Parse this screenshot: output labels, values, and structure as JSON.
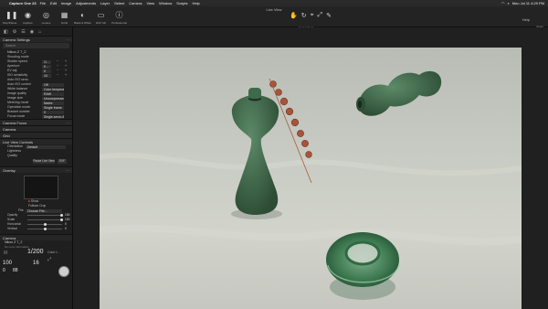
{
  "menubar": {
    "apple": "",
    "app": "Capture One 23",
    "items": [
      "File",
      "Edit",
      "Image",
      "Adjustments",
      "Layer",
      "Select",
      "Camera",
      "View",
      "Window",
      "Scripts",
      "Help"
    ],
    "clock": "Mon Jul 11  4:29 PM"
  },
  "toolbar": {
    "window_title": "Live View",
    "tools": [
      {
        "label": "Stop/Pause",
        "icon": "pause-icon",
        "glyph": "❚❚"
      },
      {
        "label": "Capture",
        "icon": "camera-icon",
        "glyph": "◉"
      },
      {
        "label": "Lenses",
        "icon": "lens-icon",
        "glyph": "◎"
      },
      {
        "label": "Grids",
        "icon": "grid-icon",
        "glyph": "▦"
      },
      {
        "label": "Black & White",
        "icon": "black-white-icon",
        "glyph": "◐"
      },
      {
        "label": "EVF full",
        "icon": "evf-icon",
        "glyph": "▭"
      },
      {
        "label": "Professional",
        "icon": "info-icon",
        "glyph": "ⓘ"
      }
    ],
    "cursor_tools_label": "Cursor Tools",
    "cursor_tools": [
      "✋",
      "↻",
      "⌖",
      "⤢",
      "✎"
    ],
    "right_label": "Help",
    "right_label2": "Zoom"
  },
  "panel": {
    "icons": [
      "◧",
      "⚙",
      "☰",
      "◉",
      "⌂"
    ],
    "camera_settings": "Camera Settings",
    "search_placeholder": "Search",
    "device": "Nikon Z 7_2",
    "rows": [
      {
        "label": "Shooting mode",
        "value": ""
      },
      {
        "label": "Shutter speed",
        "value": "1/..."
      },
      {
        "label": "Aperture",
        "value": "f/..."
      },
      {
        "label": "EV adj",
        "value": "0"
      },
      {
        "label": "ISO sensitivity",
        "value": "10"
      },
      {
        "label": "Auto ISO sens.",
        "value": ""
      },
      {
        "label": "Auto ISO control",
        "value": "Off"
      },
      {
        "label": "White balance",
        "value": "Color temperat..."
      },
      {
        "label": "Image quality",
        "value": "RAW"
      },
      {
        "label": "Image size",
        "value": "Uncompressed"
      },
      {
        "label": "Metering mode",
        "value": "Matrix"
      },
      {
        "label": "Operation mode",
        "value": "Single frame"
      },
      {
        "label": "Bracket number",
        "value": "0"
      },
      {
        "label": "Focus mode",
        "value": "Single-servo AF"
      }
    ],
    "sections": {
      "camera_focus": "Camera Focus",
      "camera": "Camera",
      "grid": "Grid",
      "live_view_controls": "Live View Controls",
      "overlay": "Overlay",
      "camera_bottom": "Camera"
    },
    "lvc": {
      "orientation_label": "Orientation",
      "orientation_value": "Default",
      "lightness_label": "Lightness",
      "quality_label": "Quality",
      "pause_button": "Pause Live View",
      "extra_button": "EVF"
    },
    "overlay": {
      "show_label": "Show",
      "fullsize_label": "Fullsize Crop",
      "file_label": "File",
      "file_value": "Choose File...",
      "opacity_label": "Opacity",
      "opacity_value": 100,
      "scale_label": "Scale",
      "scale_value": 100,
      "horizontal_label": "Horizontal",
      "horizontal_value": 0,
      "vertical_label": "Vertical",
      "vertical_value": 0
    },
    "camera": {
      "name": "Nikon Z 7_2",
      "sub": "No Lens Information",
      "shutter": "1/200",
      "iso": "100",
      "aperture": "16",
      "ev": "0",
      "shots": "88",
      "mode": "M",
      "wb": "Color t..."
    }
  }
}
